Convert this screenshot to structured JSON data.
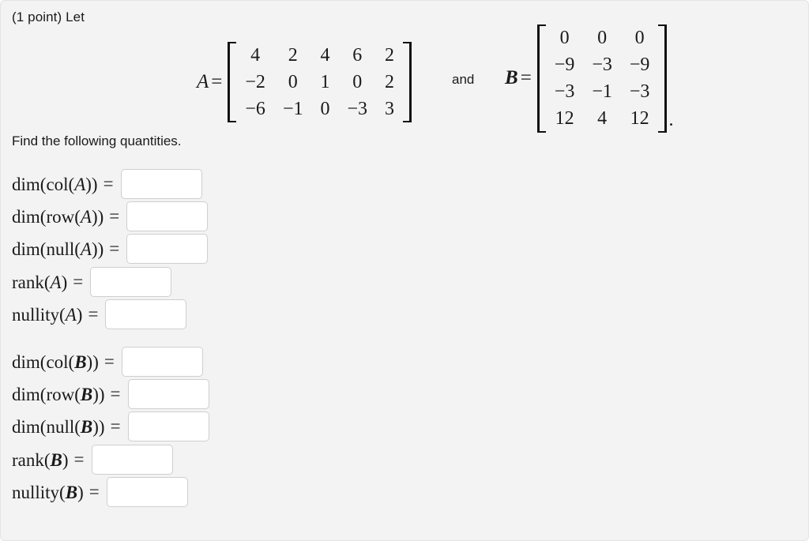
{
  "problem": {
    "points_line": "(1 point) Let",
    "instruction": "Find the following quantities.",
    "conjunction": "and",
    "trailing_period": "."
  },
  "matrices": [
    {
      "name": "A",
      "label": "A",
      "equals": "=",
      "bold_label": false,
      "rows": 3,
      "cols": 5,
      "values": [
        [
          "4",
          "2",
          "4",
          "6",
          "2"
        ],
        [
          "-2",
          "0",
          "1",
          "0",
          "2"
        ],
        [
          "-6",
          "-1",
          "0",
          "-3",
          "3"
        ]
      ]
    },
    {
      "name": "B",
      "label": "B",
      "equals": "=",
      "bold_label": true,
      "rows": 4,
      "cols": 3,
      "values": [
        [
          "0",
          "0",
          "0"
        ],
        [
          "-9",
          "-3",
          "-9"
        ],
        [
          "-3",
          "-1",
          "-3"
        ],
        [
          "12",
          "4",
          "12"
        ]
      ]
    }
  ],
  "questions": [
    {
      "id": "dim-col-a",
      "prefix": "dim(col(",
      "variable": "A",
      "suffix": "))",
      "equals": "=",
      "variable_bold": false,
      "value": "",
      "placeholder": ""
    },
    {
      "id": "dim-row-a",
      "prefix": "dim(row(",
      "variable": "A",
      "suffix": "))",
      "equals": "=",
      "variable_bold": false,
      "value": "",
      "placeholder": ""
    },
    {
      "id": "dim-null-a",
      "prefix": "dim(null(",
      "variable": "A",
      "suffix": "))",
      "equals": "=",
      "variable_bold": false,
      "value": "",
      "placeholder": ""
    },
    {
      "id": "rank-a",
      "prefix": "rank(",
      "variable": "A",
      "suffix": ")",
      "equals": "=",
      "variable_bold": false,
      "value": "",
      "placeholder": ""
    },
    {
      "id": "nullity-a",
      "prefix": "nullity(",
      "variable": "A",
      "suffix": ")",
      "equals": "=",
      "variable_bold": false,
      "value": "",
      "placeholder": ""
    },
    {
      "id": "dim-col-b",
      "prefix": "dim(col(",
      "variable": "B",
      "suffix": "))",
      "equals": "=",
      "variable_bold": true,
      "value": "",
      "placeholder": ""
    },
    {
      "id": "dim-row-b",
      "prefix": "dim(row(",
      "variable": "B",
      "suffix": "))",
      "equals": "=",
      "variable_bold": true,
      "value": "",
      "placeholder": ""
    },
    {
      "id": "dim-null-b",
      "prefix": "dim(null(",
      "variable": "B",
      "suffix": "))",
      "equals": "=",
      "variable_bold": true,
      "value": "",
      "placeholder": ""
    },
    {
      "id": "rank-b",
      "prefix": "rank(",
      "variable": "B",
      "suffix": ")",
      "equals": "=",
      "variable_bold": true,
      "value": "",
      "placeholder": ""
    },
    {
      "id": "nullity-b",
      "prefix": "nullity(",
      "variable": "B",
      "suffix": ")",
      "equals": "=",
      "variable_bold": true,
      "value": "",
      "placeholder": ""
    }
  ],
  "layout": {
    "question_tops": [
      213,
      254,
      295,
      337,
      378,
      438,
      479,
      520,
      562,
      603
    ],
    "colors": {
      "page_background": "#f3f3f3",
      "input_background": "#ffffff",
      "input_border": "#cfcfcf",
      "text": "#1a1a1a"
    }
  }
}
